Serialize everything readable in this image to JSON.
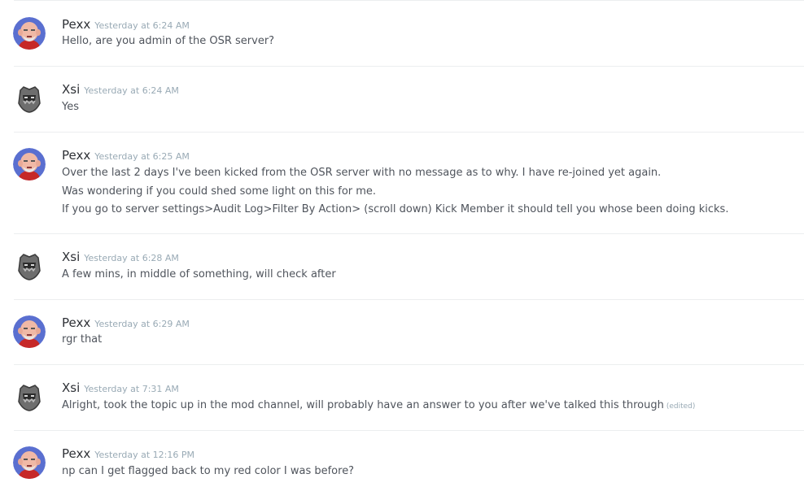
{
  "users": {
    "pexx": {
      "name": "Pexx",
      "avatar_icon": "bald-old-man-avatar-icon",
      "avatar_bg": "#5a6fd0"
    },
    "xsi": {
      "name": "Xsi",
      "avatar_icon": "gray-helmet-avatar-icon",
      "avatar_bg": "#ffffff"
    }
  },
  "messages": [
    {
      "author": "Pexx",
      "timestamp": "Yesterday at 6:24 AM",
      "lines": [
        "Hello, are you admin of the OSR server?"
      ]
    },
    {
      "author": "Xsi",
      "timestamp": "Yesterday at 6:24 AM",
      "lines": [
        "Yes"
      ]
    },
    {
      "author": "Pexx",
      "timestamp": "Yesterday at 6:25 AM",
      "lines": [
        "Over the last 2 days I've been kicked from the OSR server with no message as to why. I have re-joined yet again.",
        "Was wondering if you could shed some light on this for me.",
        "If you go to server settings>Audit Log>Filter By Action> (scroll down) Kick Member it should tell you whose been doing kicks."
      ]
    },
    {
      "author": "Xsi",
      "timestamp": "Yesterday at 6:28 AM",
      "lines": [
        "A few mins, in middle of something, will check after"
      ]
    },
    {
      "author": "Pexx",
      "timestamp": "Yesterday at 6:29 AM",
      "lines": [
        "rgr that"
      ]
    },
    {
      "author": "Xsi",
      "timestamp": "Yesterday at 7:31 AM",
      "lines": [
        "Alright, took the topic up in the mod channel, will probably have an answer to you after we've talked this through"
      ],
      "edited": "(edited)"
    },
    {
      "author": "Pexx",
      "timestamp": "Yesterday at 12:16 PM",
      "lines": [
        "np can I get flagged back to my red color I was before?"
      ]
    }
  ]
}
